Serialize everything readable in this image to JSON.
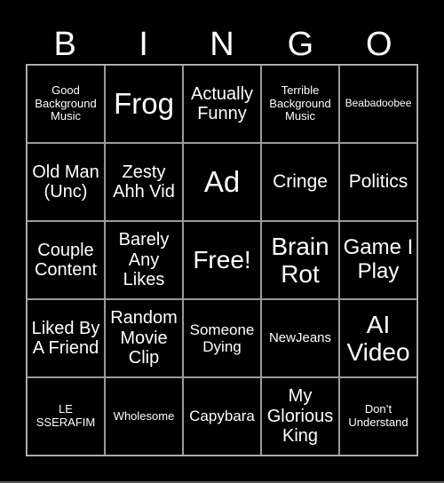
{
  "header": {
    "letters": [
      "B",
      "I",
      "N",
      "G",
      "O"
    ]
  },
  "board": {
    "cells": [
      "Good Background Music",
      "Frog",
      "Actually Funny",
      "Terrible Background Music",
      "Beabadoobee",
      "Old Man (Unc)",
      "Zesty Ahh Vid",
      "Ad",
      "Cringe",
      "Politics",
      "Couple Content",
      "Barely Any Likes",
      "Free!",
      "Brain Rot",
      "Game I Play",
      "Liked By A Friend",
      "Random Movie Clip",
      "Someone Dying",
      "NewJeans",
      "AI Video",
      "LE SSERAFIM",
      "Wholesome",
      "Capybara",
      "My Glorious King",
      "Don’t Understand"
    ]
  },
  "colors": {
    "background": "#000000",
    "text": "#ffffff",
    "grid": "#9a9a9a"
  }
}
